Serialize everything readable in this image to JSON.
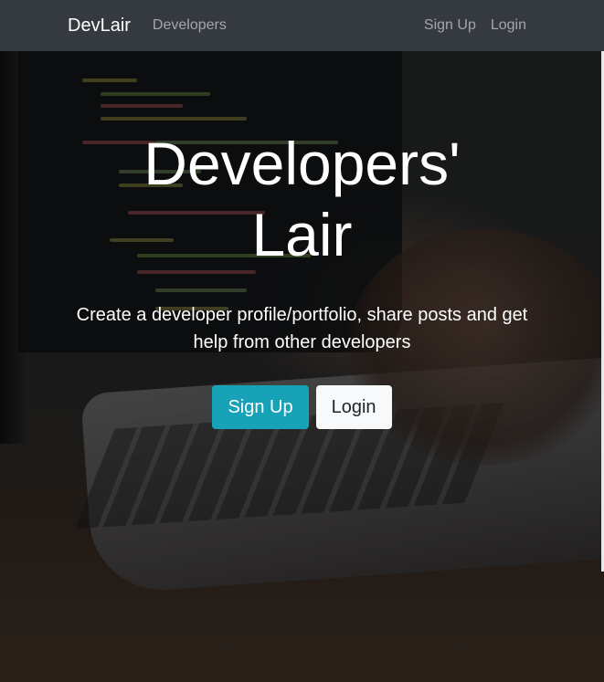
{
  "navbar": {
    "brand": "DevLair",
    "links": {
      "developers": "Developers",
      "signup": "Sign Up",
      "login": "Login"
    }
  },
  "hero": {
    "title": "Developers' Lair",
    "lead": "Create a developer profile/portfolio, share posts and get help from other developers",
    "buttons": {
      "signup": "Sign Up",
      "login": "Login"
    }
  },
  "colors": {
    "navbar_bg": "#343a40",
    "primary_button": "#17a2b8",
    "secondary_button": "#f8f9fa"
  }
}
